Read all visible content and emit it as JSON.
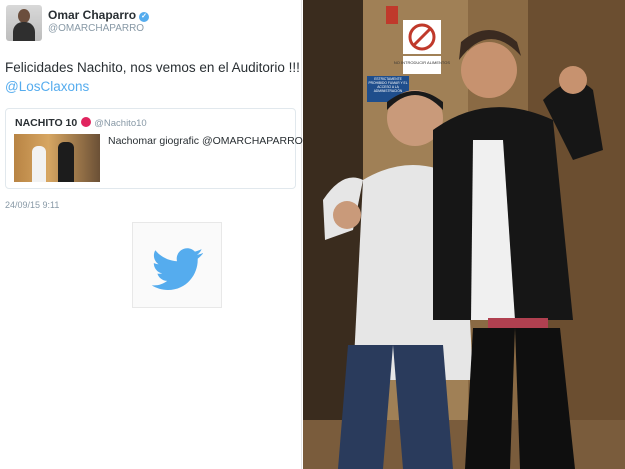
{
  "tweet": {
    "author_name": "Omar Chaparro",
    "author_handle": "@OMARCHAPARRO",
    "text": "Felicidades Nachito, nos vemos en el Auditorio !!!",
    "mention_link": "@LosClaxons",
    "timestamp": "24/09/15 9:11"
  },
  "quoted_tweet": {
    "author_name": "NACHITO 10",
    "author_handle": "@Nachito10",
    "text": "Nachomar giografic @OMARCHAPARRO"
  },
  "icons": {
    "verified": "verified-badge-icon",
    "logo": "twitter-bird-icon"
  },
  "photo": {
    "sign_top": "NO INTRODUCIR ALIMENTOS",
    "sign_left": "ESTRICTAMENTE PROHIBIDO FUMAR Y EL ACCESO A LA ADMINISTRACIÓN"
  },
  "colors": {
    "twitter_blue": "#55acee",
    "text": "#292f33",
    "muted": "#8899a6"
  }
}
